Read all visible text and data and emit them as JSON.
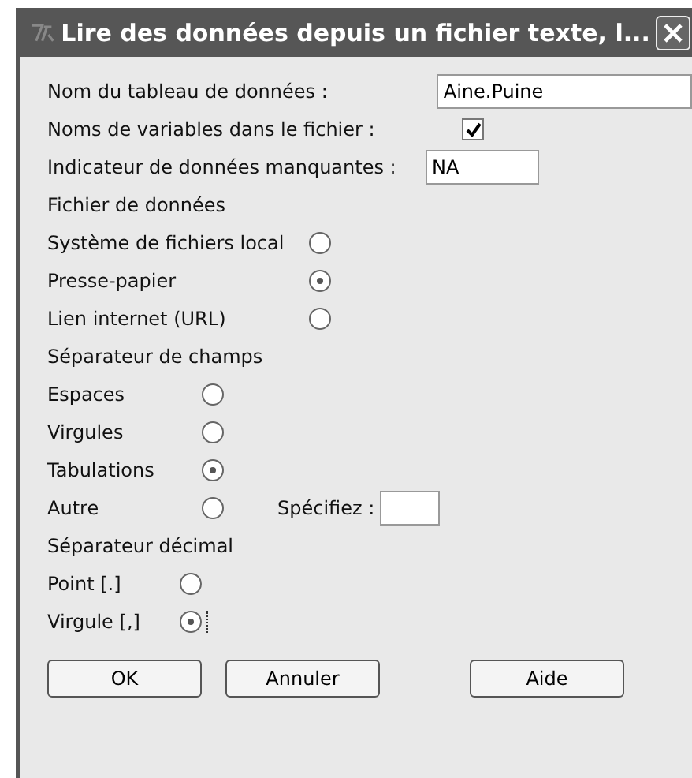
{
  "window": {
    "title": "Lire des données depuis un fichier texte, l..."
  },
  "fields": [
    {
      "kind": "text",
      "label": "Nom du tableau de données :",
      "value": "Aine.Puine"
    },
    {
      "kind": "checkbox",
      "label": "Noms de variables dans le fichier :",
      "checked": true
    },
    {
      "kind": "text",
      "label": "Indicateur de données manquantes :",
      "value": "NA"
    }
  ],
  "groups": [
    {
      "heading": "Fichier de données",
      "options": [
        {
          "label": "Système de fichiers local",
          "selected": false
        },
        {
          "label": "Presse-papier",
          "selected": true
        },
        {
          "label": "Lien internet (URL)",
          "selected": false
        }
      ]
    },
    {
      "heading": "Séparateur de champs",
      "options": [
        {
          "label": "Espaces",
          "selected": false
        },
        {
          "label": "Virgules",
          "selected": false
        },
        {
          "label": "Tabulations",
          "selected": true
        },
        {
          "label": "Autre",
          "selected": false,
          "specify_label": "Spécifiez :"
        }
      ]
    },
    {
      "heading": "Séparateur décimal",
      "options": [
        {
          "label": "Point [.]",
          "selected": false
        },
        {
          "label": "Virgule [,]",
          "selected": true,
          "focused": true
        }
      ]
    }
  ],
  "buttons": [
    "OK",
    "Annuler",
    "Aide"
  ]
}
